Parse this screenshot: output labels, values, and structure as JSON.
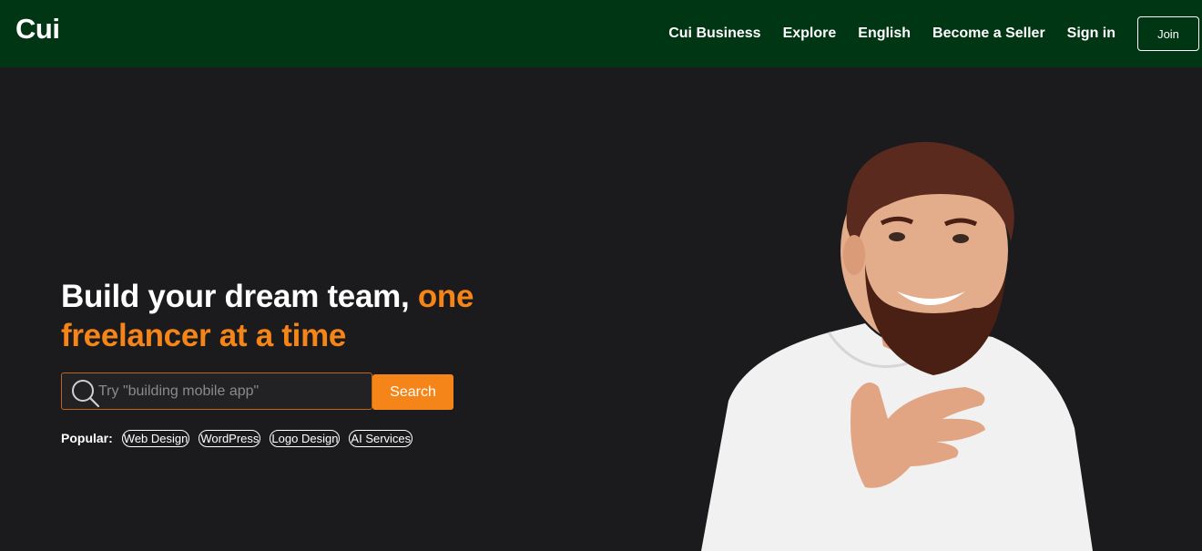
{
  "header": {
    "logo": "Cui",
    "nav": [
      "Cui Business",
      "Explore",
      "English",
      "Become a Seller",
      "Sign in"
    ],
    "join_label": "Join"
  },
  "hero": {
    "title_main": "Build your dream team, ",
    "title_accent": "one freelancer at a time",
    "search": {
      "placeholder": "Try \"building mobile app\"",
      "button_label": "Search"
    },
    "popular": {
      "label": "Popular:",
      "tags": [
        "Web Design",
        "WordPress",
        "Logo Design",
        "AI Services"
      ]
    },
    "image_alt": "Smiling bearded man in white t-shirt"
  },
  "colors": {
    "header_bg": "#003614",
    "page_bg": "#1b1b1d",
    "accent": "#f58518"
  }
}
